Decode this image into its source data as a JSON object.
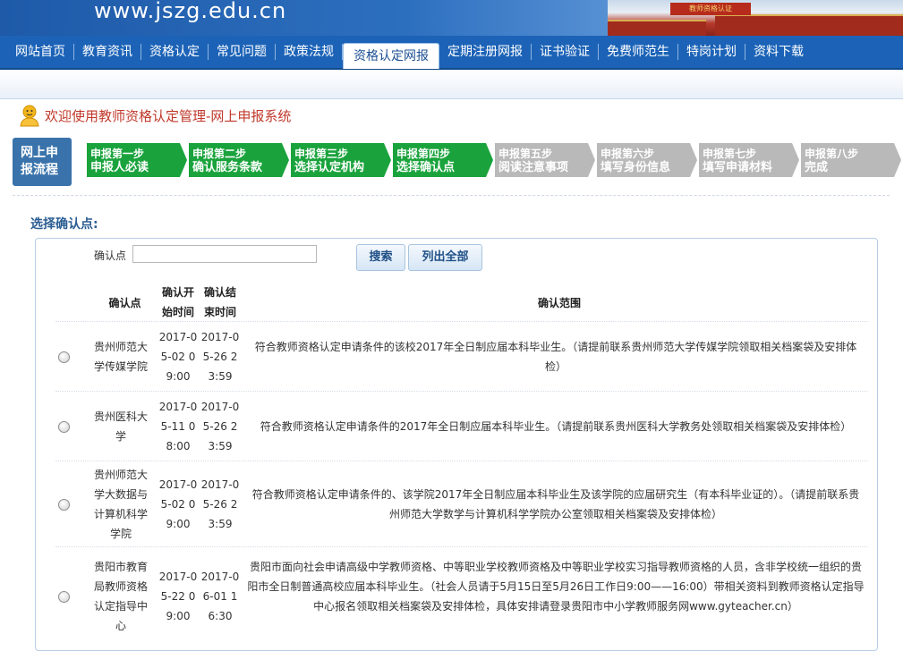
{
  "header": {
    "site_url": "www.jszg.edu.cn",
    "banner_text": "教师资格认证"
  },
  "nav": {
    "items": [
      {
        "label": "网站首页"
      },
      {
        "label": "教育资讯"
      },
      {
        "label": "资格认定"
      },
      {
        "label": "常见问题"
      },
      {
        "label": "政策法规"
      },
      {
        "label": "资格认定网报",
        "active": true
      },
      {
        "label": "定期注册网报"
      },
      {
        "label": "证书验证"
      },
      {
        "label": "免费师范生"
      },
      {
        "label": "特岗计划"
      },
      {
        "label": "资料下载"
      }
    ]
  },
  "welcome": {
    "text": "欢迎使用教师资格认定管理-网上申报系统",
    "icon": "user-avatar-icon"
  },
  "steps": {
    "label_line1": "网上申",
    "label_line2": "报流程",
    "items": [
      {
        "line1": "申报第一步",
        "line2": "申报人必读",
        "status": "done"
      },
      {
        "line1": "申报第二步",
        "line2": "确认服务条款",
        "status": "done"
      },
      {
        "line1": "申报第三步",
        "line2": "选择认定机构",
        "status": "done"
      },
      {
        "line1": "申报第四步",
        "line2": "选择确认点",
        "status": "done"
      },
      {
        "line1": "申报第五步",
        "line2": "阅读注意事项",
        "status": "todo"
      },
      {
        "line1": "申报第六步",
        "line2": "填写身份信息",
        "status": "todo"
      },
      {
        "line1": "申报第七步",
        "line2": "填写申请材料",
        "status": "todo"
      },
      {
        "line1": "申报第八步",
        "line2": "完成",
        "status": "todo"
      }
    ],
    "colors": {
      "done": "#1aa33c",
      "todo": "#b9b9b9"
    }
  },
  "section": {
    "title": "选择确认点:"
  },
  "search": {
    "label": "确认点",
    "value": "",
    "search_button": "搜索",
    "list_all_button": "列出全部"
  },
  "table": {
    "headers": {
      "point": "确认点",
      "start_line1": "确认开",
      "start_line2": "始时间",
      "end_line1": "确认结",
      "end_line2": "束时间",
      "scope": "确认范围"
    },
    "rows": [
      {
        "point": "贵州师范大学传媒学院",
        "start": "2017-05-02 09:00",
        "end": "2017-05-26 23:59",
        "scope": "符合教师资格认定申请条件的该校2017年全日制应届本科毕业生。（请提前联系贵州师范大学传媒学院领取相关档案袋及安排体检）"
      },
      {
        "point": "贵州医科大学",
        "start": "2017-05-11 08:00",
        "end": "2017-05-26 23:59",
        "scope": "符合教师资格认定申请条件的2017年全日制应届本科毕业生。（请提前联系贵州医科大学教务处领取相关档案袋及安排体检）"
      },
      {
        "point": "贵州师范大学大数据与计算机科学学院",
        "start": "2017-05-02 09:00",
        "end": "2017-05-26 23:59",
        "scope": "符合教师资格认定申请条件的、该学院2017年全日制应届本科毕业生及该学院的应届研究生（有本科毕业证的）。（请提前联系贵州师范大学数学与计算机科学学院办公室领取相关档案袋及安排体检）"
      },
      {
        "point": "贵阳市教育局教师资格认定指导中心",
        "start": "2017-05-22 09:00",
        "end": "2017-06-01 16:30",
        "scope": "贵阳市面向社会申请高级中学教师资格、中等职业学校教师资格及中等职业学校实习指导教师资格的人员，含非学校统一组织的贵阳市全日制普通高校应届本科毕业生。（社会人员请于5月15日至5月26日工作日9:00——16:00）带相关资料到教师资格认定指导中心报名领取相关档案袋及安排体检，具体安排请登录贵阳市中小学教师服务网www.gyteacher.cn）"
      }
    ]
  }
}
